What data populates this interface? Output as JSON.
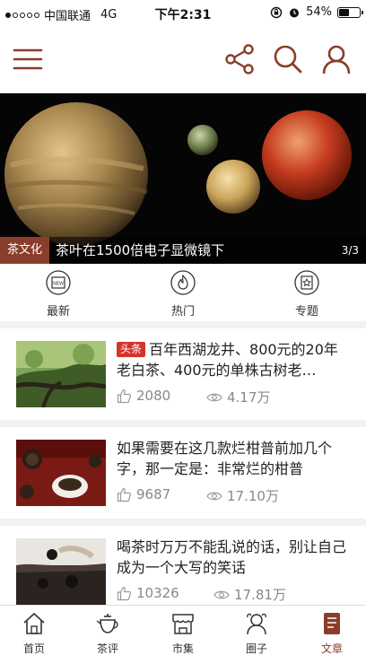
{
  "status_bar": {
    "carrier": "中国联通",
    "network": "4G",
    "time": "下午2:31",
    "battery": "54%",
    "battery_level": 0.54
  },
  "top_nav": {
    "menu_icon": "menu-icon",
    "share_icon": "share-icon",
    "search_icon": "search-icon",
    "user_icon": "user-icon",
    "accent_color": "#8b3d2b"
  },
  "banner": {
    "tag": "茶文化",
    "title": "茶叶在1500倍电子显微镜下",
    "index": "3/3"
  },
  "categories": [
    {
      "label": "最新",
      "icon": "new-icon"
    },
    {
      "label": "热门",
      "icon": "fire-icon"
    },
    {
      "label": "专题",
      "icon": "topic-icon"
    }
  ],
  "articles": [
    {
      "badge": "头条",
      "title": "百年西湖龙井、800元的20年老白茶、400元的单株古树老…",
      "likes": "2080",
      "views": "4.17万"
    },
    {
      "badge": "",
      "title": "如果需要在这几款烂柑普前加几个字，那一定是：非常烂的柑普",
      "likes": "9687",
      "views": "17.10万"
    },
    {
      "badge": "",
      "title": "喝茶时万万不能乱说的话，别让自己成为一个大写的笑话",
      "likes": "10326",
      "views": "17.81万"
    }
  ],
  "tabbar": [
    {
      "label": "首页",
      "icon": "home-icon",
      "active": false
    },
    {
      "label": "茶评",
      "icon": "teapot-icon",
      "active": false
    },
    {
      "label": "市集",
      "icon": "shop-icon",
      "active": false
    },
    {
      "label": "圈子",
      "icon": "circle-icon",
      "active": false
    },
    {
      "label": "文章",
      "icon": "article-icon",
      "active": true
    }
  ]
}
